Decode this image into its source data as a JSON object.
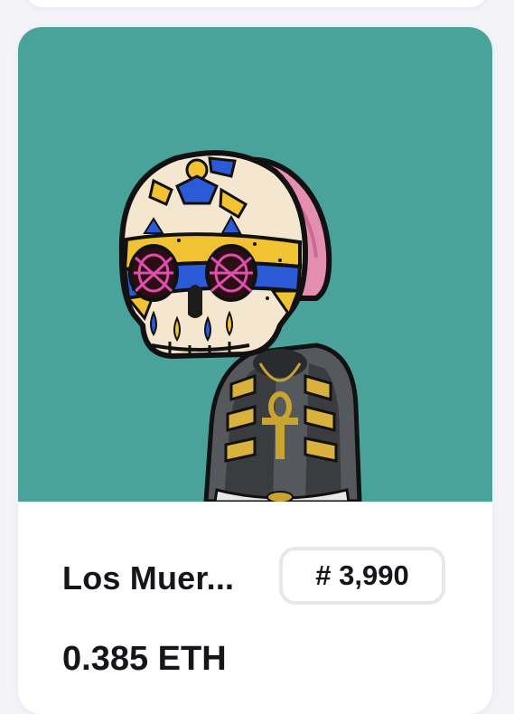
{
  "nft_card": {
    "name": "Los Muer...",
    "token_number": "# 3,990",
    "price": "0.385 ETH",
    "background_color": "#4aa39a",
    "image_subject": "sugar-skull-character"
  }
}
